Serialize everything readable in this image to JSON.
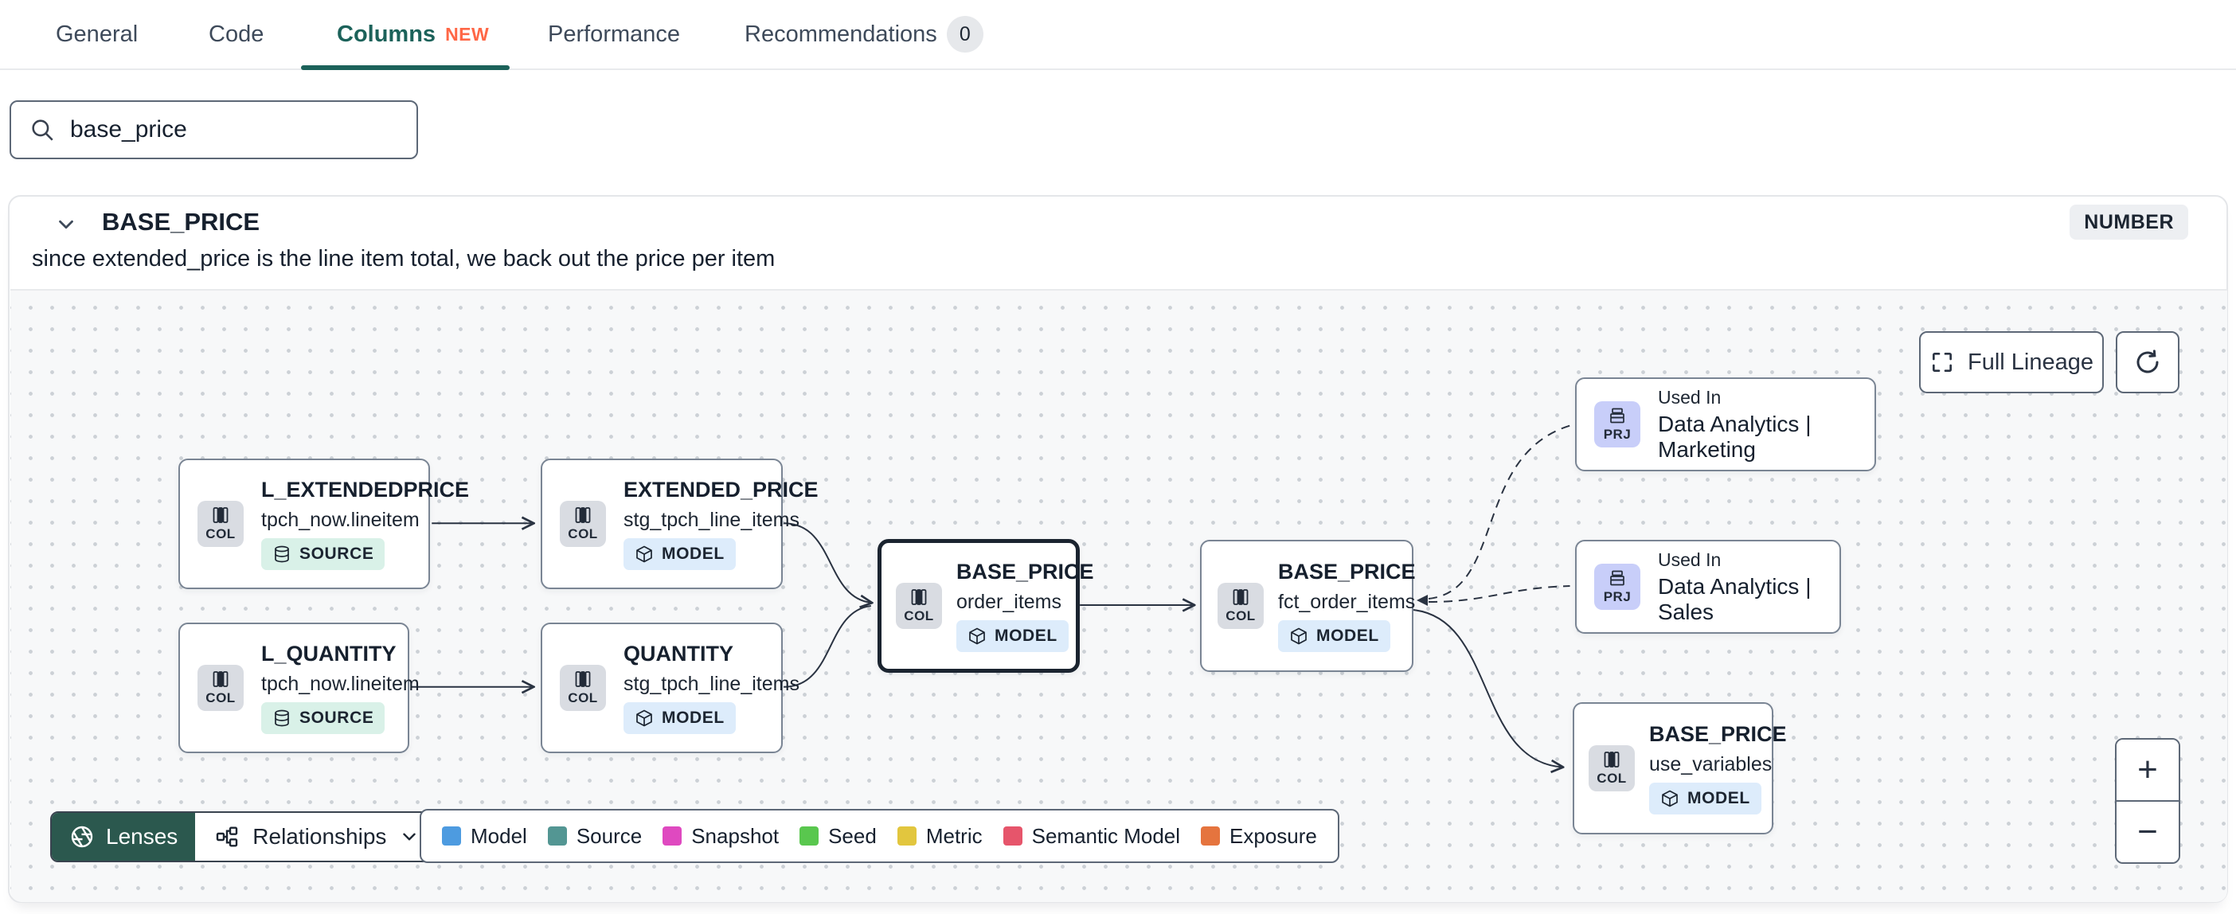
{
  "tabs": [
    {
      "label": "General"
    },
    {
      "label": "Code"
    },
    {
      "label": "Columns",
      "badge": "NEW",
      "active": true
    },
    {
      "label": "Performance"
    },
    {
      "label": "Recommendations",
      "count": "0"
    }
  ],
  "search": {
    "value": "base_price"
  },
  "column_panel": {
    "name": "BASE_PRICE",
    "type_badge": "NUMBER",
    "description": "since extended_price is the line item total, we back out the price per item"
  },
  "lineage": {
    "nodes": [
      {
        "title": "L_EXTENDEDPRICE",
        "subtitle": "tpch_now.lineitem",
        "chip": "COL",
        "badge": "SOURCE"
      },
      {
        "title": "EXTENDED_PRICE",
        "subtitle": "stg_tpch_line_items",
        "chip": "COL",
        "badge": "MODEL"
      },
      {
        "title": "L_QUANTITY",
        "subtitle": "tpch_now.lineitem",
        "chip": "COL",
        "badge": "SOURCE"
      },
      {
        "title": "QUANTITY",
        "subtitle": "stg_tpch_line_items",
        "chip": "COL",
        "badge": "MODEL"
      },
      {
        "title": "BASE_PRICE",
        "subtitle": "order_items",
        "chip": "COL",
        "badge": "MODEL",
        "selected": true
      },
      {
        "title": "BASE_PRICE",
        "subtitle": "fct_order_items",
        "chip": "COL",
        "badge": "MODEL"
      },
      {
        "label": "Used In",
        "title": "Data Analytics | Marketing",
        "chip": "PRJ"
      },
      {
        "label": "Used In",
        "title": "Data Analytics | Sales",
        "chip": "PRJ"
      },
      {
        "title": "BASE_PRICE",
        "subtitle": "use_variables",
        "chip": "COL",
        "badge": "MODEL"
      }
    ],
    "toolbar": {
      "full_lineage": "Full Lineage"
    },
    "controls": {
      "lenses": "Lenses",
      "relationships": "Relationships",
      "zoom_in": "+",
      "zoom_out": "−"
    },
    "legend": [
      {
        "label": "Model",
        "color": "#4d9be0"
      },
      {
        "label": "Source",
        "color": "#539693"
      },
      {
        "label": "Snapshot",
        "color": "#df49c0"
      },
      {
        "label": "Seed",
        "color": "#59c74e"
      },
      {
        "label": "Metric",
        "color": "#e2c63e"
      },
      {
        "label": "Semantic Model",
        "color": "#e6556b"
      },
      {
        "label": "Exposure",
        "color": "#e5743e"
      }
    ],
    "colors": {
      "accent_teal": "#1c625a",
      "lenses_green": "#2b584e",
      "new_orange": "#ff6746"
    }
  }
}
